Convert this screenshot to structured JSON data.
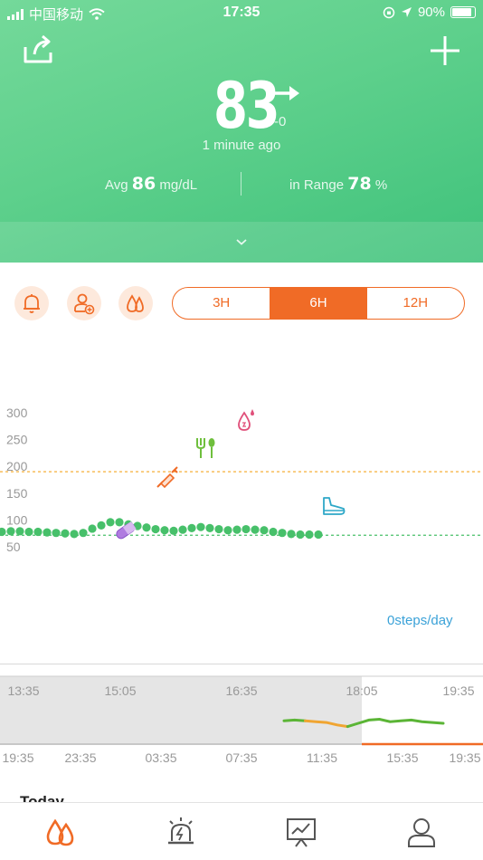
{
  "status_bar": {
    "carrier": "中国移动",
    "time": "17:35",
    "battery": "90%"
  },
  "header": {
    "glucose_value": "83",
    "delta": "-0",
    "updated": "1 minute ago",
    "avg_label": "Avg",
    "avg_value": "86",
    "avg_unit": "mg/dL",
    "range_label": "in Range",
    "range_value": "78",
    "range_unit": "%"
  },
  "toolbar": {
    "icons": [
      "bell-icon",
      "add-doctor-icon",
      "drops-icon"
    ],
    "ranges": [
      "3H",
      "6H",
      "12H"
    ],
    "active_range": "6H"
  },
  "colors": {
    "accent": "#f06b26",
    "green": "#47c06a",
    "target_high": "#f4a623",
    "target_low": "#47c06a",
    "link": "#3ba2d8"
  },
  "chart_data": [
    {
      "type": "scatter",
      "y_ticks": [
        "300",
        "250",
        "200",
        "150",
        "100",
        "50"
      ],
      "ylim": [
        40,
        320
      ],
      "target_high": 180,
      "target_low": 80,
      "series": [
        {
          "x": [
            0,
            10,
            20,
            30,
            40,
            50,
            60,
            70,
            80,
            90,
            100,
            110,
            120,
            130,
            140,
            150,
            160,
            170,
            180,
            190,
            200,
            210,
            220,
            230,
            240,
            250,
            260,
            270,
            280,
            290,
            300,
            310,
            320,
            330,
            340,
            350
          ],
          "values": [
            88,
            89,
            89,
            88,
            88,
            87,
            86,
            85,
            84,
            86,
            94,
            100,
            106,
            106,
            102,
            99,
            96,
            93,
            91,
            90,
            92,
            95,
            97,
            95,
            93,
            91,
            92,
            93,
            92,
            91,
            88,
            86,
            84,
            83,
            83,
            83
          ]
        }
      ],
      "events": [
        "insulin-icon",
        "meal-icon",
        "blood-drop-icon",
        "pill-icon",
        "exercise-icon"
      ],
      "steps": "0steps/day"
    },
    {
      "type": "line",
      "top_ticks": [
        "13:35",
        "15:05",
        "16:35",
        "18:05",
        "19:35"
      ],
      "bottom_ticks": [
        "19:35",
        "23:35",
        "03:35",
        "07:35",
        "11:35",
        "15:35",
        "19:35"
      ],
      "values": [
        93,
        94,
        93,
        92,
        91,
        88,
        86,
        90,
        94,
        95,
        92,
        93,
        94,
        92,
        91,
        90
      ]
    }
  ],
  "nav": {
    "items": [
      "glucose-tab",
      "alerts-tab",
      "reports-tab",
      "profile-tab"
    ],
    "active": "glucose-tab"
  },
  "section": {
    "today": "Today"
  }
}
